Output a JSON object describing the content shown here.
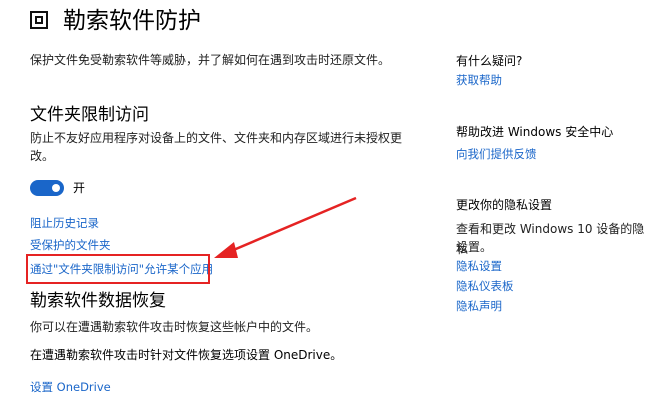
{
  "header": {
    "title": "勒索软件防护",
    "description": "保护文件免受勒索软件等威胁，并了解如何在遇到攻击时还原文件。"
  },
  "cfa": {
    "heading": "文件夹限制访问",
    "description_line1": "防止不友好应用程序对设备上的文件、文件夹和内存区域进行未授权更",
    "description_line2": "改。",
    "toggle_state": "开",
    "toggle_on": true,
    "links": [
      "阻止历史记录",
      "受保护的文件夹",
      "通过\"文件夹限制访问\"允许某个应用"
    ]
  },
  "recovery": {
    "heading": "勒索软件数据恢复",
    "description": "你可以在遭遇勒索软件攻击时恢复这些帐户中的文件。",
    "onedrive_text": "在遭遇勒索软件攻击时针对文件恢复选项设置 OneDrive。",
    "onedrive_link": "设置 OneDrive"
  },
  "sidebar": {
    "help": {
      "title": "有什么疑问?",
      "link": "获取帮助"
    },
    "improve": {
      "title": "帮助改进 Windows 安全中心",
      "link": "向我们提供反馈"
    },
    "privacy": {
      "title": "更改你的隐私设置",
      "text_line1": "查看和更改 Windows 10 设备的隐私",
      "text_line2": "设置。",
      "links": [
        "隐私设置",
        "隐私仪表板",
        "隐私声明"
      ]
    }
  },
  "colors": {
    "link": "#1a66c9",
    "accent": "#1a66c9",
    "highlight": "#e52323"
  }
}
